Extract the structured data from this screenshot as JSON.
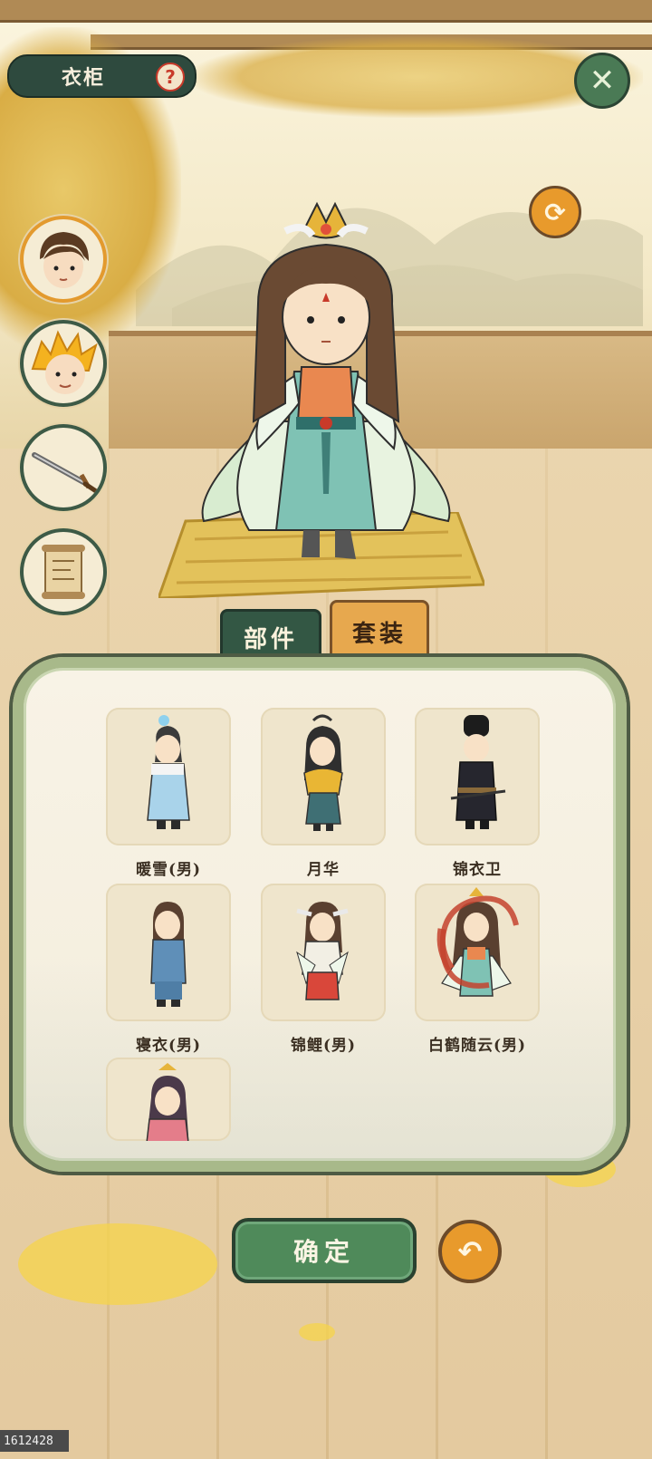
{
  "header": {
    "title": "衣柜",
    "help_icon": "question-icon",
    "close_icon": "close-x-icon",
    "refresh_icon": "refresh-icon"
  },
  "side_buttons": [
    {
      "name": "face-brown-hair",
      "icon": "character-face-icon",
      "active": true
    },
    {
      "name": "face-golden-hair",
      "icon": "golden-hair-face-icon",
      "active": false
    },
    {
      "name": "weapon",
      "icon": "sword-icon",
      "active": false
    },
    {
      "name": "scroll",
      "icon": "scroll-icon",
      "active": false
    }
  ],
  "tabs": {
    "parts": "部件",
    "sets": "套装",
    "active": "parts"
  },
  "outfits": [
    {
      "label": "暖雪(男)",
      "palette": "#a9d3ea"
    },
    {
      "label": "月华",
      "palette": "#3f6f74"
    },
    {
      "label": "锦衣卫",
      "palette": "#26262e"
    },
    {
      "label": "寝衣(男)",
      "palette": "#5f8fb8"
    },
    {
      "label": "锦鲤(男)",
      "palette": "#d9473a"
    },
    {
      "label": "白鹤随云(男)",
      "palette": "#7fc2b4",
      "selected": true
    },
    {
      "label": "",
      "palette": "#e47d8a"
    }
  ],
  "footer": {
    "confirm_label": "确定",
    "back_icon": "undo-arrow-icon",
    "uid": "1612428"
  },
  "colors": {
    "primary_green": "#4f8a5a",
    "accent_orange": "#e89a2c",
    "dark_green": "#2e4a3e"
  }
}
